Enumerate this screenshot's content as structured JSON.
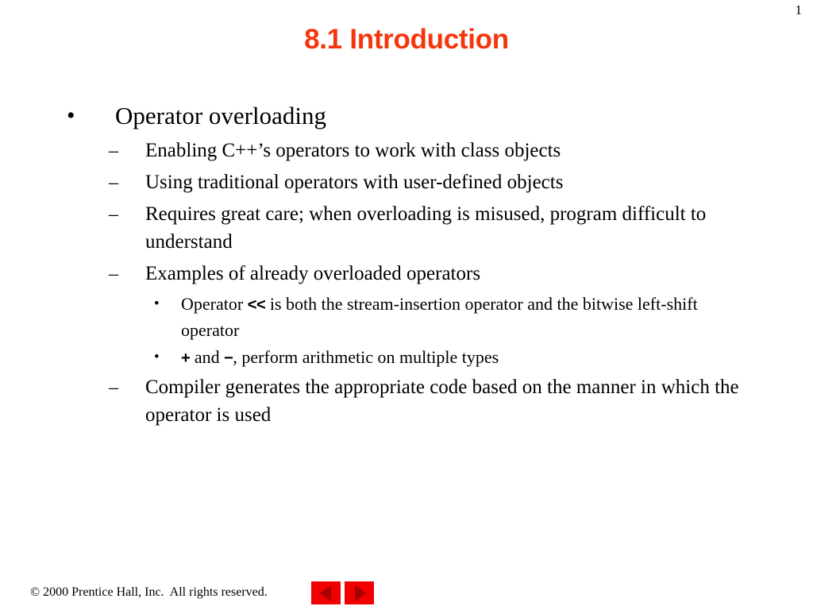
{
  "slide": {
    "page_number": "1",
    "title": "8.1 Introduction",
    "title_color": "#F4360C",
    "background_color": "#FFFFFF",
    "text_color": "#000000"
  },
  "markers": {
    "level1": "•",
    "level2": "–",
    "level3": "•"
  },
  "content": {
    "l1_operator_overloading": "Operator overloading",
    "l2_enabling": "Enabling C++’s operators to work with class objects",
    "l2_using_traditional": "Using traditional operators with user-defined objects",
    "l2_requires_care": "Requires great care; when overloading is misused, program difficult to understand",
    "l2_examples": "Examples of already overloaded operators",
    "l3_shift_pre": "Operator ",
    "l3_shift_op": "<<",
    "l3_shift_post": " is both the stream-insertion operator and the bitwise left-shift operator",
    "l3_plus_op": "+",
    "l3_plus_mid": " and ",
    "l3_minus_op": "−",
    "l3_plus_post": ", perform arithmetic on multiple types",
    "l2_compiler": "Compiler generates the appropriate code based on the manner in which the operator is used"
  },
  "footer": {
    "copyright": "© 2000 Prentice Hall, Inc.  All rights reserved.",
    "nav_back_label": "◀",
    "nav_forward_label": "▶",
    "nav_button_color": "#F20000",
    "nav_arrow_color": "#A80000"
  }
}
